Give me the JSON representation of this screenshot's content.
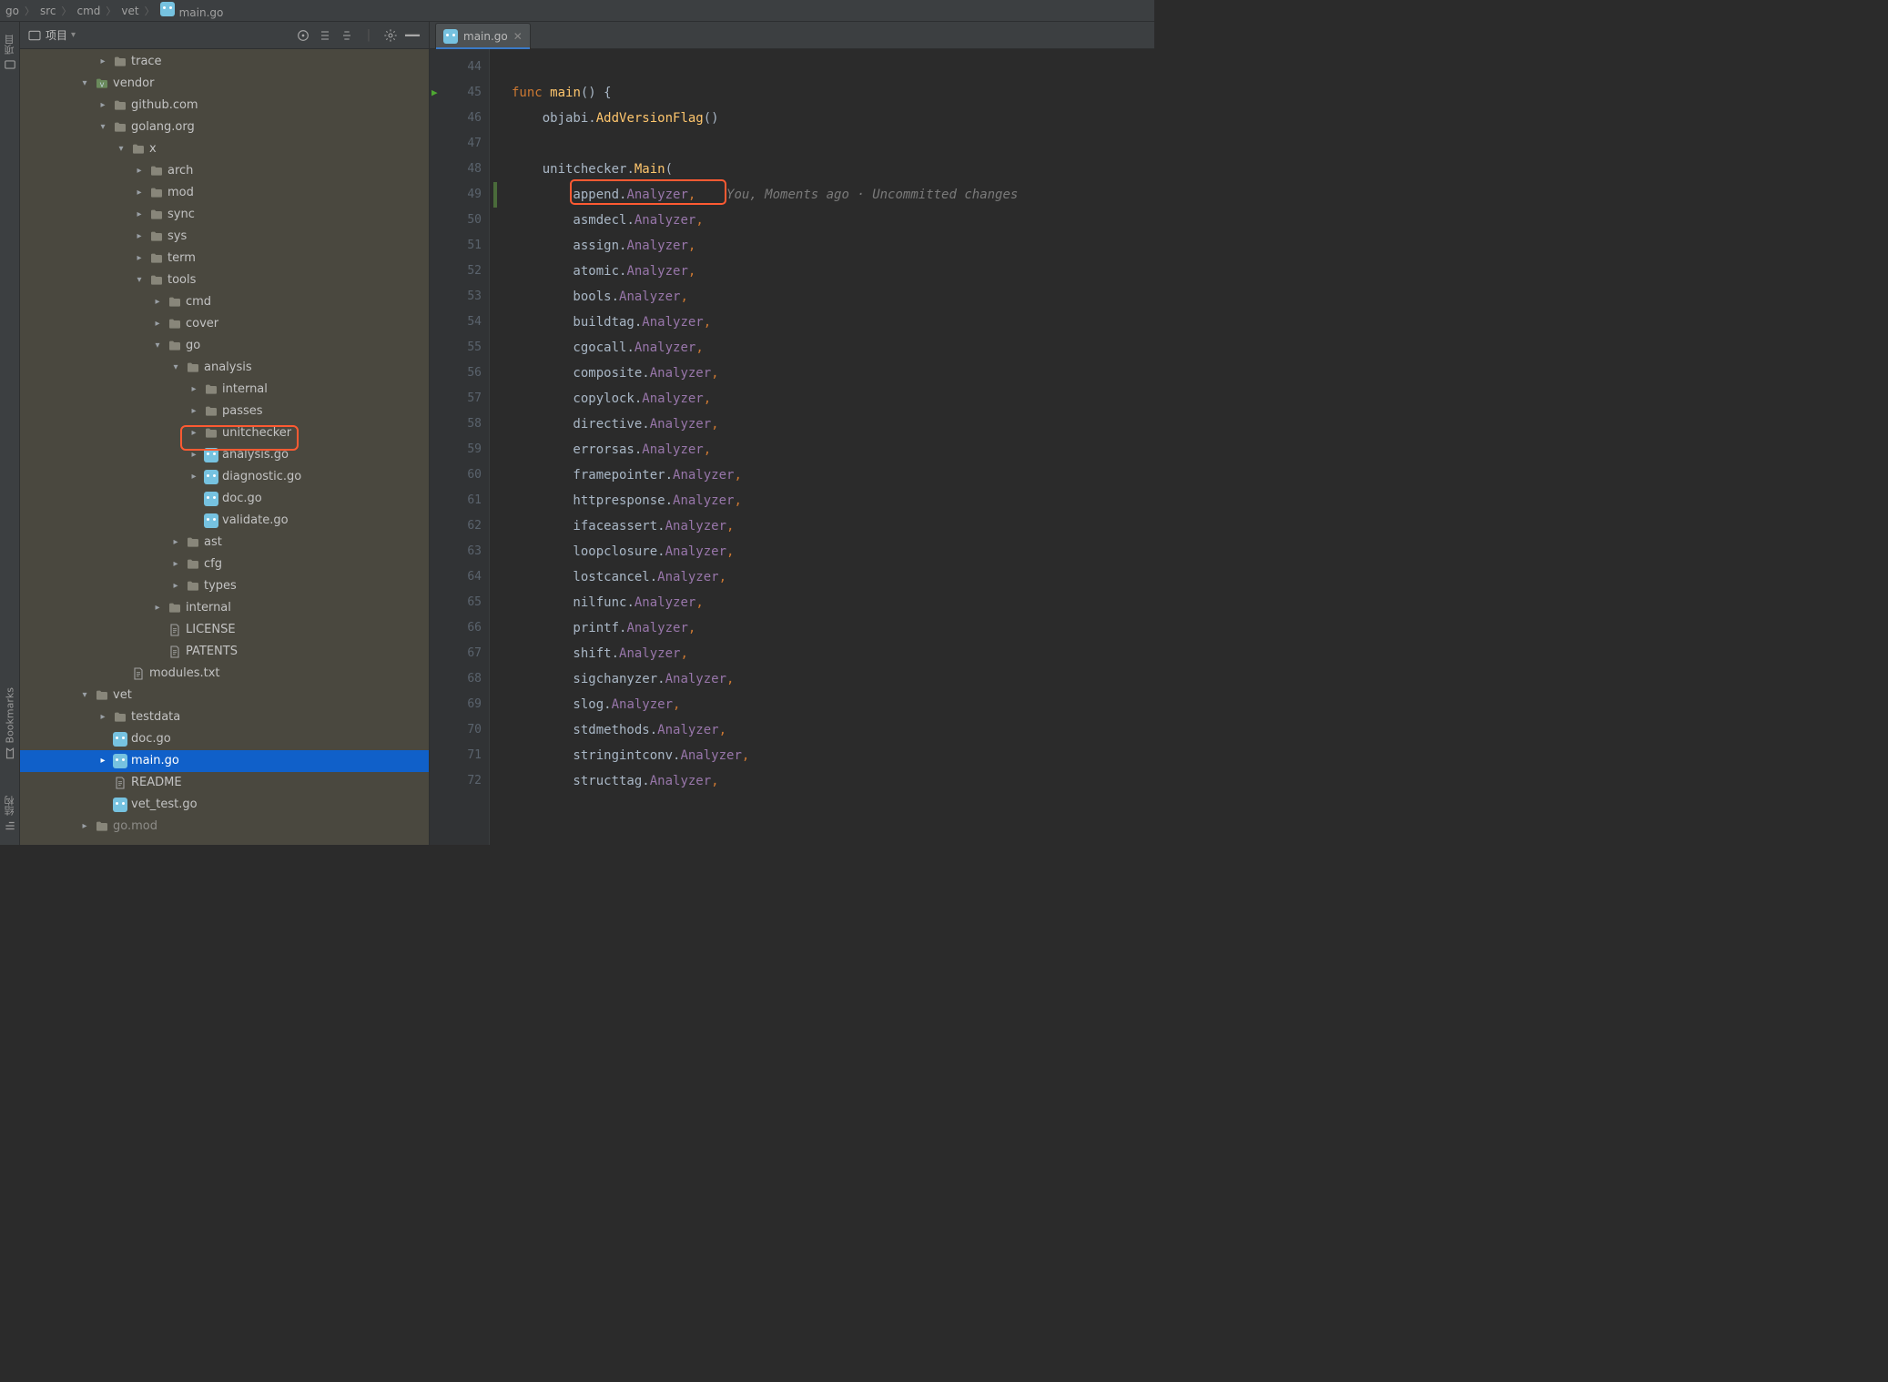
{
  "breadcrumb": [
    "go",
    "src",
    "cmd",
    "vet",
    "main.go"
  ],
  "sidebar": {
    "project_label": "项目",
    "tools": {
      "structure": "结构",
      "bookmarks": "Bookmarks",
      "project": "项目"
    }
  },
  "tree": [
    {
      "d": 4,
      "a": "closed",
      "k": "folder",
      "t": "trace"
    },
    {
      "d": 3,
      "a": "open",
      "k": "folder",
      "t": "vendor",
      "vendor": true
    },
    {
      "d": 4,
      "a": "closed",
      "k": "folder",
      "t": "github.com"
    },
    {
      "d": 4,
      "a": "open",
      "k": "folder",
      "t": "golang.org"
    },
    {
      "d": 5,
      "a": "open",
      "k": "folder",
      "t": "x"
    },
    {
      "d": 6,
      "a": "closed",
      "k": "folder",
      "t": "arch"
    },
    {
      "d": 6,
      "a": "closed",
      "k": "folder",
      "t": "mod"
    },
    {
      "d": 6,
      "a": "closed",
      "k": "folder",
      "t": "sync"
    },
    {
      "d": 6,
      "a": "closed",
      "k": "folder",
      "t": "sys"
    },
    {
      "d": 6,
      "a": "closed",
      "k": "folder",
      "t": "term"
    },
    {
      "d": 6,
      "a": "open",
      "k": "folder",
      "t": "tools"
    },
    {
      "d": 7,
      "a": "closed",
      "k": "folder",
      "t": "cmd"
    },
    {
      "d": 7,
      "a": "closed",
      "k": "folder",
      "t": "cover"
    },
    {
      "d": 7,
      "a": "open",
      "k": "folder",
      "t": "go"
    },
    {
      "d": 8,
      "a": "open",
      "k": "folder",
      "t": "analysis"
    },
    {
      "d": 9,
      "a": "closed",
      "k": "folder",
      "t": "internal"
    },
    {
      "d": 9,
      "a": "closed",
      "k": "folder",
      "t": "passes",
      "hl": true
    },
    {
      "d": 9,
      "a": "closed",
      "k": "folder",
      "t": "unitchecker"
    },
    {
      "d": 9,
      "a": "closed",
      "k": "go",
      "t": "analysis.go"
    },
    {
      "d": 9,
      "a": "closed",
      "k": "go",
      "t": "diagnostic.go"
    },
    {
      "d": 9,
      "a": "none",
      "k": "go",
      "t": "doc.go"
    },
    {
      "d": 9,
      "a": "none",
      "k": "go",
      "t": "validate.go"
    },
    {
      "d": 8,
      "a": "closed",
      "k": "folder",
      "t": "ast"
    },
    {
      "d": 8,
      "a": "closed",
      "k": "folder",
      "t": "cfg"
    },
    {
      "d": 8,
      "a": "closed",
      "k": "folder",
      "t": "types"
    },
    {
      "d": 7,
      "a": "closed",
      "k": "folder",
      "t": "internal"
    },
    {
      "d": 7,
      "a": "none",
      "k": "txt",
      "t": "LICENSE"
    },
    {
      "d": 7,
      "a": "none",
      "k": "txt",
      "t": "PATENTS"
    },
    {
      "d": 5,
      "a": "none",
      "k": "txt",
      "t": "modules.txt"
    },
    {
      "d": 3,
      "a": "open",
      "k": "folder",
      "t": "vet"
    },
    {
      "d": 4,
      "a": "closed",
      "k": "folder",
      "t": "testdata"
    },
    {
      "d": 4,
      "a": "none",
      "k": "go",
      "t": "doc.go"
    },
    {
      "d": 4,
      "a": "closed",
      "k": "go",
      "t": "main.go",
      "sel": true
    },
    {
      "d": 4,
      "a": "none",
      "k": "txt",
      "t": "README"
    },
    {
      "d": 4,
      "a": "none",
      "k": "go",
      "t": "vet_test.go"
    },
    {
      "d": 3,
      "a": "closed",
      "k": "folder-dashed",
      "t": "go.mod",
      "faded": true
    }
  ],
  "editor": {
    "tab": {
      "label": "main.go"
    },
    "blame": "You, Moments ago · Uncommitted changes",
    "lines": [
      {
        "n": 44,
        "raw": ""
      },
      {
        "n": 45,
        "run": true,
        "tokens": [
          [
            "kw",
            "func "
          ],
          [
            "fn",
            "main"
          ],
          [
            "punc",
            "() {"
          ]
        ]
      },
      {
        "n": 46,
        "tokens": [
          [
            "pkg",
            "    objabi"
          ],
          [
            "punc",
            "."
          ],
          [
            "fn",
            "AddVersionFlag"
          ],
          [
            "punc",
            "()"
          ]
        ]
      },
      {
        "n": 47,
        "raw": ""
      },
      {
        "n": 48,
        "tokens": [
          [
            "pkg",
            "    unitchecker"
          ],
          [
            "punc",
            "."
          ],
          [
            "fn",
            "Main"
          ],
          [
            "punc",
            "("
          ]
        ]
      },
      {
        "n": 49,
        "vcs": true,
        "hl": true,
        "tokens": [
          [
            "pkg",
            "        append"
          ],
          [
            "punc",
            "."
          ],
          [
            "prop",
            "Analyzer"
          ],
          [
            "orange",
            ","
          ]
        ],
        "blame": true
      },
      {
        "n": 50,
        "tokens": [
          [
            "pkg",
            "        asmdecl"
          ],
          [
            "punc",
            "."
          ],
          [
            "prop",
            "Analyzer"
          ],
          [
            "orange",
            ","
          ]
        ]
      },
      {
        "n": 51,
        "tokens": [
          [
            "pkg",
            "        assign"
          ],
          [
            "punc",
            "."
          ],
          [
            "prop",
            "Analyzer"
          ],
          [
            "orange",
            ","
          ]
        ]
      },
      {
        "n": 52,
        "tokens": [
          [
            "pkg",
            "        atomic"
          ],
          [
            "punc",
            "."
          ],
          [
            "prop",
            "Analyzer"
          ],
          [
            "orange",
            ","
          ]
        ]
      },
      {
        "n": 53,
        "tokens": [
          [
            "pkg",
            "        bools"
          ],
          [
            "punc",
            "."
          ],
          [
            "prop",
            "Analyzer"
          ],
          [
            "orange",
            ","
          ]
        ]
      },
      {
        "n": 54,
        "tokens": [
          [
            "pkg",
            "        buildtag"
          ],
          [
            "punc",
            "."
          ],
          [
            "prop",
            "Analyzer"
          ],
          [
            "orange",
            ","
          ]
        ]
      },
      {
        "n": 55,
        "tokens": [
          [
            "pkg",
            "        cgocall"
          ],
          [
            "punc",
            "."
          ],
          [
            "prop",
            "Analyzer"
          ],
          [
            "orange",
            ","
          ]
        ]
      },
      {
        "n": 56,
        "tokens": [
          [
            "pkg",
            "        composite"
          ],
          [
            "punc",
            "."
          ],
          [
            "prop",
            "Analyzer"
          ],
          [
            "orange",
            ","
          ]
        ]
      },
      {
        "n": 57,
        "tokens": [
          [
            "pkg",
            "        copylock"
          ],
          [
            "punc",
            "."
          ],
          [
            "prop",
            "Analyzer"
          ],
          [
            "orange",
            ","
          ]
        ]
      },
      {
        "n": 58,
        "tokens": [
          [
            "pkg",
            "        directive"
          ],
          [
            "punc",
            "."
          ],
          [
            "prop",
            "Analyzer"
          ],
          [
            "orange",
            ","
          ]
        ]
      },
      {
        "n": 59,
        "tokens": [
          [
            "pkg",
            "        errorsas"
          ],
          [
            "punc",
            "."
          ],
          [
            "prop",
            "Analyzer"
          ],
          [
            "orange",
            ","
          ]
        ]
      },
      {
        "n": 60,
        "tokens": [
          [
            "pkg",
            "        framepointer"
          ],
          [
            "punc",
            "."
          ],
          [
            "prop",
            "Analyzer"
          ],
          [
            "orange",
            ","
          ]
        ]
      },
      {
        "n": 61,
        "tokens": [
          [
            "pkg",
            "        httpresponse"
          ],
          [
            "punc",
            "."
          ],
          [
            "prop",
            "Analyzer"
          ],
          [
            "orange",
            ","
          ]
        ]
      },
      {
        "n": 62,
        "tokens": [
          [
            "pkg",
            "        ifaceassert"
          ],
          [
            "punc",
            "."
          ],
          [
            "prop",
            "Analyzer"
          ],
          [
            "orange",
            ","
          ]
        ]
      },
      {
        "n": 63,
        "tokens": [
          [
            "pkg",
            "        loopclosure"
          ],
          [
            "punc",
            "."
          ],
          [
            "prop",
            "Analyzer"
          ],
          [
            "orange",
            ","
          ]
        ]
      },
      {
        "n": 64,
        "tokens": [
          [
            "pkg",
            "        lostcancel"
          ],
          [
            "punc",
            "."
          ],
          [
            "prop",
            "Analyzer"
          ],
          [
            "orange",
            ","
          ]
        ]
      },
      {
        "n": 65,
        "tokens": [
          [
            "pkg",
            "        nilfunc"
          ],
          [
            "punc",
            "."
          ],
          [
            "prop",
            "Analyzer"
          ],
          [
            "orange",
            ","
          ]
        ]
      },
      {
        "n": 66,
        "tokens": [
          [
            "pkg",
            "        printf"
          ],
          [
            "punc",
            "."
          ],
          [
            "prop",
            "Analyzer"
          ],
          [
            "orange",
            ","
          ]
        ]
      },
      {
        "n": 67,
        "tokens": [
          [
            "pkg",
            "        shift"
          ],
          [
            "punc",
            "."
          ],
          [
            "prop",
            "Analyzer"
          ],
          [
            "orange",
            ","
          ]
        ]
      },
      {
        "n": 68,
        "tokens": [
          [
            "pkg",
            "        sigchanyzer"
          ],
          [
            "punc",
            "."
          ],
          [
            "prop",
            "Analyzer"
          ],
          [
            "orange",
            ","
          ]
        ]
      },
      {
        "n": 69,
        "tokens": [
          [
            "pkg",
            "        slog"
          ],
          [
            "punc",
            "."
          ],
          [
            "prop",
            "Analyzer"
          ],
          [
            "orange",
            ","
          ]
        ]
      },
      {
        "n": 70,
        "tokens": [
          [
            "pkg",
            "        stdmethods"
          ],
          [
            "punc",
            "."
          ],
          [
            "prop",
            "Analyzer"
          ],
          [
            "orange",
            ","
          ]
        ]
      },
      {
        "n": 71,
        "tokens": [
          [
            "pkg",
            "        stringintconv"
          ],
          [
            "punc",
            "."
          ],
          [
            "prop",
            "Analyzer"
          ],
          [
            "orange",
            ","
          ]
        ]
      },
      {
        "n": 72,
        "tokens": [
          [
            "pkg",
            "        structtag"
          ],
          [
            "punc",
            "."
          ],
          [
            "prop",
            "Analyzer"
          ],
          [
            "orange",
            ","
          ]
        ]
      }
    ]
  }
}
